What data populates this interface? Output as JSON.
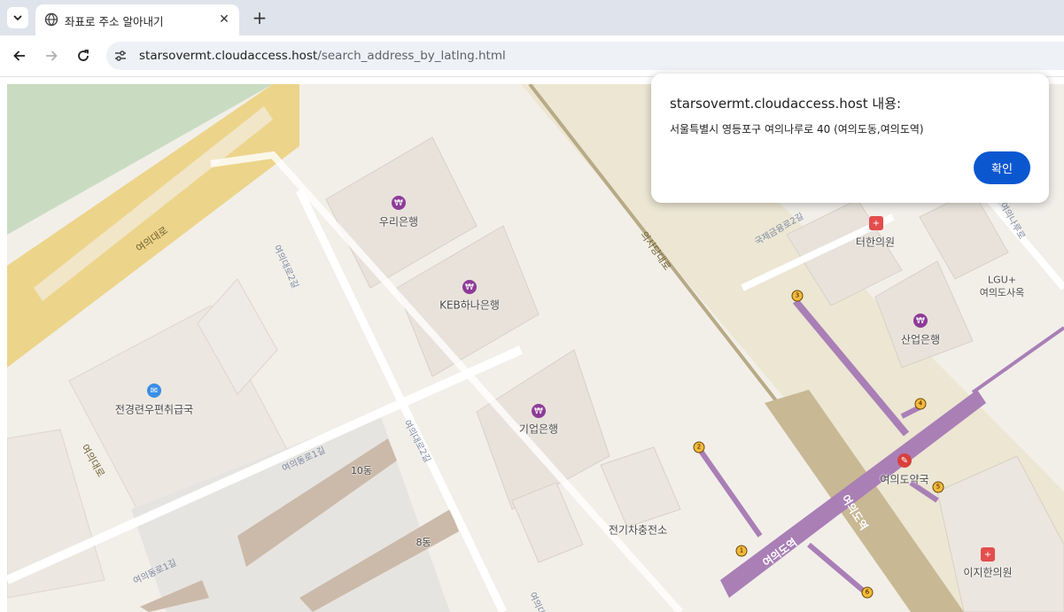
{
  "browser": {
    "tab_title": "좌표로 주소 알아내기",
    "tab_close": "✕",
    "new_tab": "+",
    "url_host": "starsovermt.cloudaccess.host",
    "url_path": "/search_address_by_latlng.html"
  },
  "dialog": {
    "title": "starsovermt.cloudaccess.host 내용:",
    "message": "서울특별시 영등포구 여의나루로 40 (여의도동,여의도역)",
    "ok_label": "확인"
  },
  "map": {
    "places": {
      "woori_bank": "우리은행",
      "keb_hana_bank": "KEB하나은행",
      "ibk_bank": "기업은행",
      "post_office": "전경련우편취급국",
      "terhan_clinic": "터한의원",
      "lgu_line1": "LGU+",
      "lgu_line2": "여의도사옥",
      "kdb_bank": "산업은행",
      "yeouido_pharmacy": "여의도약국",
      "ev_charging": "전기차충전소",
      "ijihan_clinic": "이지한의원",
      "bldg_10": "10동",
      "bldg_8": "8동"
    },
    "roads": {
      "yeouidaero_top": "여의대로",
      "yeouidaero_left": "여의대로",
      "uisadang_daero": "의사당대로",
      "yeouidaero_2gil": "여의대로2길",
      "yeouidong_1gil": "여의동로1길",
      "yeouidaero_2gil_b": "여의대로2길",
      "yeouidong_1gil_b": "여의동로1길",
      "yeouidaero_bottom": "여의대로",
      "gukjegeumyung_2gil": "국제금융로2길",
      "yeouinaru_road": "여의나루로"
    },
    "stations": {
      "yeouido_station_a": "여의도역",
      "yeouido_station_b": "여의도역"
    },
    "exits": [
      "1",
      "2",
      "3",
      "4",
      "5",
      "6"
    ]
  }
}
